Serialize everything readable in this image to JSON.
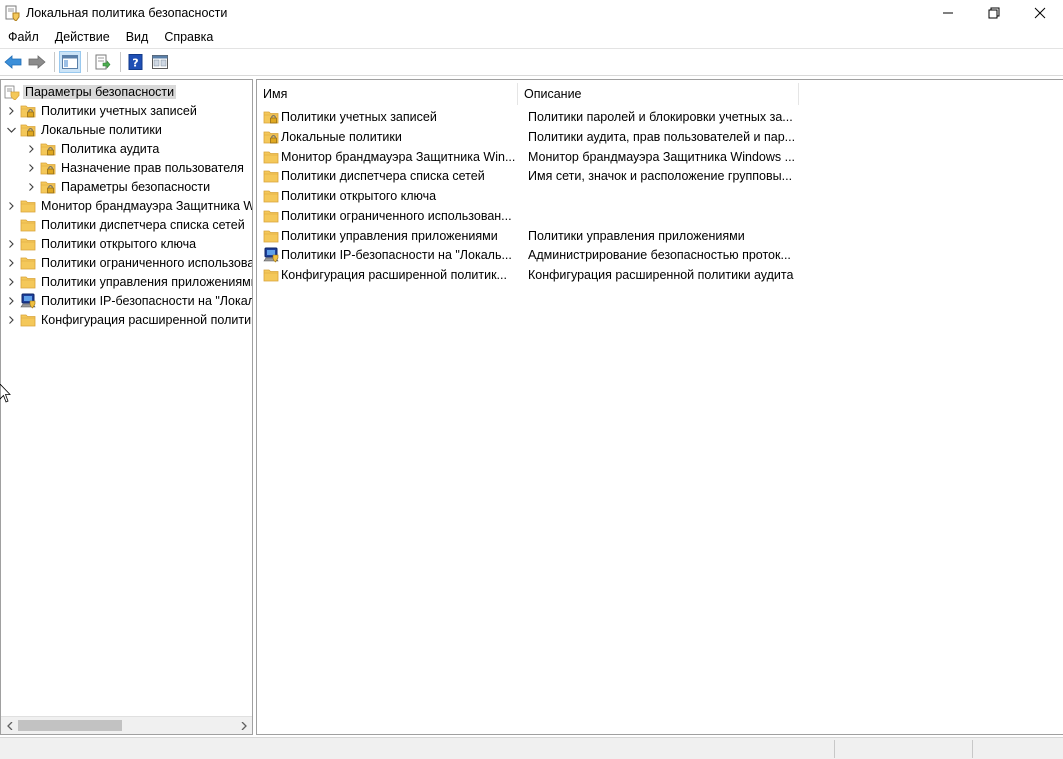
{
  "window": {
    "title": "Локальная политика безопасности",
    "controls": {
      "minimize": "—",
      "restore": "❐",
      "close": "✕"
    }
  },
  "menu": [
    "Файл",
    "Действие",
    "Вид",
    "Справка"
  ],
  "toolbar": {
    "icons": [
      "back-arrow-icon",
      "forward-arrow-icon",
      "show-hide-tree-icon",
      "export-list-icon",
      "help-icon",
      "console-view-icon"
    ]
  },
  "tree": [
    {
      "label": "Параметры безопасности",
      "level": 0,
      "expander": "none",
      "icon": "shield-folder",
      "selected": true
    },
    {
      "label": "Политики учетных записей",
      "level": 1,
      "expander": "collapsed",
      "icon": "lock-folder"
    },
    {
      "label": "Локальные политики",
      "level": 1,
      "expander": "expanded",
      "icon": "lock-folder"
    },
    {
      "label": "Политика аудита",
      "level": 2,
      "expander": "collapsed",
      "icon": "lock-folder"
    },
    {
      "label": "Назначение прав пользователя",
      "level": 2,
      "expander": "collapsed",
      "icon": "lock-folder"
    },
    {
      "label": "Параметры безопасности",
      "level": 2,
      "expander": "collapsed",
      "icon": "lock-folder"
    },
    {
      "label": "Монитор брандмауэра Защитника Windows",
      "level": 1,
      "expander": "collapsed",
      "icon": "folder"
    },
    {
      "label": "Политики диспетчера списка сетей",
      "level": 1,
      "expander": "none",
      "icon": "folder"
    },
    {
      "label": "Политики открытого ключа",
      "level": 1,
      "expander": "collapsed",
      "icon": "folder"
    },
    {
      "label": "Политики ограниченного использования программ",
      "level": 1,
      "expander": "collapsed",
      "icon": "folder"
    },
    {
      "label": "Политики управления приложениями",
      "level": 1,
      "expander": "collapsed",
      "icon": "folder"
    },
    {
      "label": "Политики IP-безопасности на \"Локальный компьютер\"",
      "level": 1,
      "expander": "collapsed",
      "icon": "ipsec"
    },
    {
      "label": "Конфигурация расширенной политики аудита",
      "level": 1,
      "expander": "collapsed",
      "icon": "folder"
    }
  ],
  "list": {
    "columns": {
      "name": "Имя",
      "description": "Описание"
    },
    "rows": [
      {
        "name": "Политики учетных записей",
        "description": "Политики паролей и блокировки учетных за...",
        "icon": "lock-folder"
      },
      {
        "name": "Локальные политики",
        "description": "Политики аудита, прав пользователей и пар...",
        "icon": "lock-folder"
      },
      {
        "name": "Монитор брандмауэра Защитника Win...",
        "description": "Монитор брандмауэра Защитника Windows ...",
        "icon": "folder"
      },
      {
        "name": "Политики диспетчера списка сетей",
        "description": "Имя сети, значок и расположение групповы...",
        "icon": "folder"
      },
      {
        "name": "Политики открытого ключа",
        "description": "",
        "icon": "folder"
      },
      {
        "name": "Политики ограниченного использован...",
        "description": "",
        "icon": "folder"
      },
      {
        "name": "Политики управления приложениями",
        "description": "Политики управления приложениями",
        "icon": "folder"
      },
      {
        "name": "Политики IP-безопасности на \"Локаль...",
        "description": "Администрирование безопасностью проток...",
        "icon": "ipsec"
      },
      {
        "name": "Конфигурация расширенной политик...",
        "description": "Конфигурация расширенной политики аудита",
        "icon": "folder"
      }
    ]
  },
  "colors": {
    "folder": "#f4c85a",
    "folder_dark": "#d9a43a",
    "selection": "#d9d9d9",
    "toolbar_active": "#cce4f7",
    "arrow_blue": "#3b8fd9"
  }
}
